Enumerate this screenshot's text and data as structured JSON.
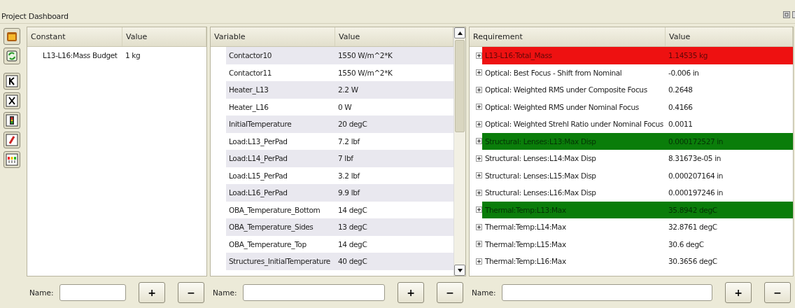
{
  "window": {
    "title": "Project Dashboard"
  },
  "toolbar": [
    {
      "kind": "project"
    },
    {
      "kind": "refresh"
    },
    {
      "kind": "constant"
    },
    {
      "kind": "variable"
    },
    {
      "kind": "signal"
    },
    {
      "kind": "pencil"
    },
    {
      "kind": "chart"
    }
  ],
  "panels": [
    {
      "kind": "constants",
      "columns": [
        "Constant",
        "Value"
      ],
      "rows": [
        {
          "name": "L13-L16:Mass Budget",
          "value": "1 kg"
        }
      ],
      "form": {
        "label": "Name:",
        "add": "+",
        "remove": "−"
      }
    },
    {
      "kind": "variables",
      "columns": [
        "Variable",
        "Value"
      ],
      "rows": [
        {
          "name": "Contactor10",
          "value": "1550 W/m^2*K"
        },
        {
          "name": "Contactor11",
          "value": "1550 W/m^2*K"
        },
        {
          "name": "Heater_L13",
          "value": "2.2 W"
        },
        {
          "name": "Heater_L16",
          "value": "0 W"
        },
        {
          "name": "InitialTemperature",
          "value": "20 degC"
        },
        {
          "name": "Load:L13_PerPad",
          "value": "7.2 lbf"
        },
        {
          "name": "Load:L14_PerPad",
          "value": "7 lbf"
        },
        {
          "name": "Load:L15_PerPad",
          "value": "3.2 lbf"
        },
        {
          "name": "Load:L16_PerPad",
          "value": "9.9 lbf"
        },
        {
          "name": "OBA_Temperature_Bottom",
          "value": "14 degC"
        },
        {
          "name": "OBA_Temperature_Sides",
          "value": "13 degC"
        },
        {
          "name": "OBA_Temperature_Top",
          "value": "14 degC"
        },
        {
          "name": "Structures_InitialTemperature",
          "value": "40 degC"
        }
      ],
      "form": {
        "label": "Name:",
        "add": "+",
        "remove": "−"
      }
    },
    {
      "kind": "requirements",
      "columns": [
        "Requirement",
        "Value"
      ],
      "rows": [
        {
          "name": "L13-L16:Total_Mass",
          "value": "1.14535 kg",
          "color": "#ee1111",
          "expanded": false
        },
        {
          "name": "Optical: Best Focus - Shift from Nominal",
          "value": "-0.006 in",
          "expanded": false
        },
        {
          "name": "Optical: Weighted RMS under Composite Focus",
          "value": "0.2648",
          "expanded": false
        },
        {
          "name": "Optical: Weighted RMS under Nominal Focus",
          "value": "0.4166",
          "expanded": false
        },
        {
          "name": "Optical: Weighted Strehl Ratio under Nominal Focus",
          "value": "0.0011",
          "expanded": false
        },
        {
          "name": "Structural: Lenses:L13:Max Disp",
          "value": "0.000172527 in",
          "color": "#0a7d0a",
          "expanded": false
        },
        {
          "name": "Structural: Lenses:L14:Max Disp",
          "value": "8.31673e-05 in",
          "expanded": false
        },
        {
          "name": "Structural: Lenses:L15:Max Disp",
          "value": "0.000207164 in",
          "expanded": false
        },
        {
          "name": "Structural: Lenses:L16:Max Disp",
          "value": "0.000197246 in",
          "expanded": false
        },
        {
          "name": "Thermal:Temp:L13:Max",
          "value": "35.8942 degC",
          "color": "#0a7d0a",
          "expanded": false
        },
        {
          "name": "Thermal:Temp:L14:Max",
          "value": "32.8761 degC",
          "expanded": false
        },
        {
          "name": "Thermal:Temp:L15:Max",
          "value": "30.6 degC",
          "expanded": false
        },
        {
          "name": "Thermal:Temp:L16:Max",
          "value": "30.3656 degC",
          "expanded": false
        }
      ],
      "form": {
        "label": "Name:",
        "add": "+",
        "remove": "−"
      }
    }
  ]
}
